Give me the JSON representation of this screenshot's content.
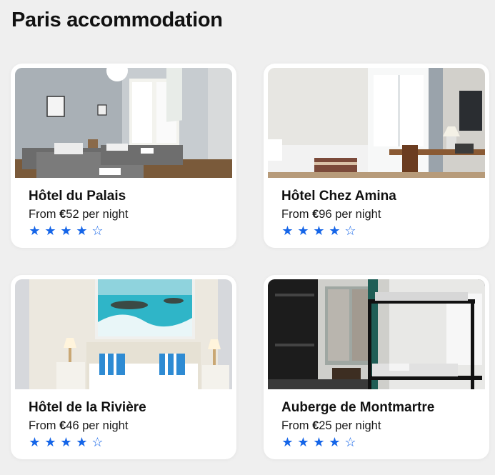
{
  "page": {
    "title": "Paris accommodation"
  },
  "colors": {
    "accent": "#1565e8",
    "background": "#efefef",
    "card": "#ffffff"
  },
  "star_icons": {
    "filled": "★",
    "empty": "☆",
    "max": 5
  },
  "hotels": [
    {
      "name": "Hôtel du Palais",
      "price_prefix": "From ",
      "currency": "€",
      "amount": "52",
      "price_suffix": " per night",
      "rating": 4,
      "photo": "twin-room-photo"
    },
    {
      "name": "Hôtel Chez Amina",
      "price_prefix": "From ",
      "currency": "€",
      "amount": "96",
      "price_suffix": " per night",
      "rating": 4,
      "photo": "bedroom-desk-photo"
    },
    {
      "name": "Hôtel de la Rivière",
      "price_prefix": "From ",
      "currency": "€",
      "amount": "46",
      "price_suffix": " per night",
      "rating": 4,
      "photo": "seaside-painting-room-photo"
    },
    {
      "name": "Auberge de Montmartre",
      "price_prefix": "From ",
      "currency": "€",
      "amount": "25",
      "price_suffix": " per night",
      "rating": 4,
      "photo": "bunk-bed-dorm-photo"
    }
  ]
}
